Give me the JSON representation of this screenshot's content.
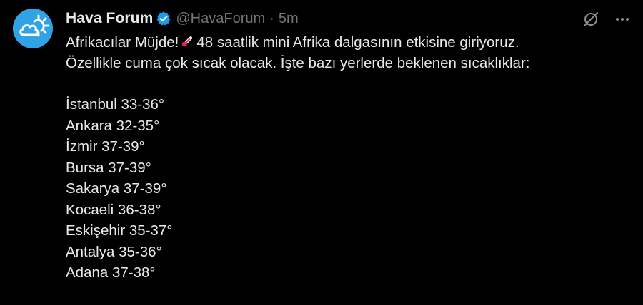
{
  "tweet": {
    "author": {
      "display_name": "Hava Forum",
      "handle": "@HavaForum",
      "verified": true,
      "avatar_icon": "cloud-sun-icon",
      "avatar_color": "#2fa3e6"
    },
    "separator": "·",
    "time": "5m",
    "text": {
      "line1_before_emoji": "Afrikacılar Müjde!",
      "emoji": "thermometer-emoji",
      "line1_after_emoji": "48 saatlik mini Afrika dalgasının etkisine giriyoruz.",
      "line2": "Özellikle cuma çok sıcak olacak. İşte bazı yerlerde beklenen sıcaklıklar:"
    },
    "cities": [
      "İstanbul 33-36°",
      "Ankara 32-35°",
      "İzmir 37-39°",
      "Bursa 37-39°",
      "Sakarya 37-39°",
      "Kocaeli 36-38°",
      "Eskişehir 35-37°",
      "Antalya 35-36°",
      "Adana 37-38°"
    ],
    "actions": [
      {
        "icon": "grok-icon"
      },
      {
        "icon": "more-icon"
      }
    ],
    "colors": {
      "background": "#000000",
      "text": "#e7e9ea",
      "secondary": "#71767b",
      "verified": "#1d9bf0"
    }
  }
}
